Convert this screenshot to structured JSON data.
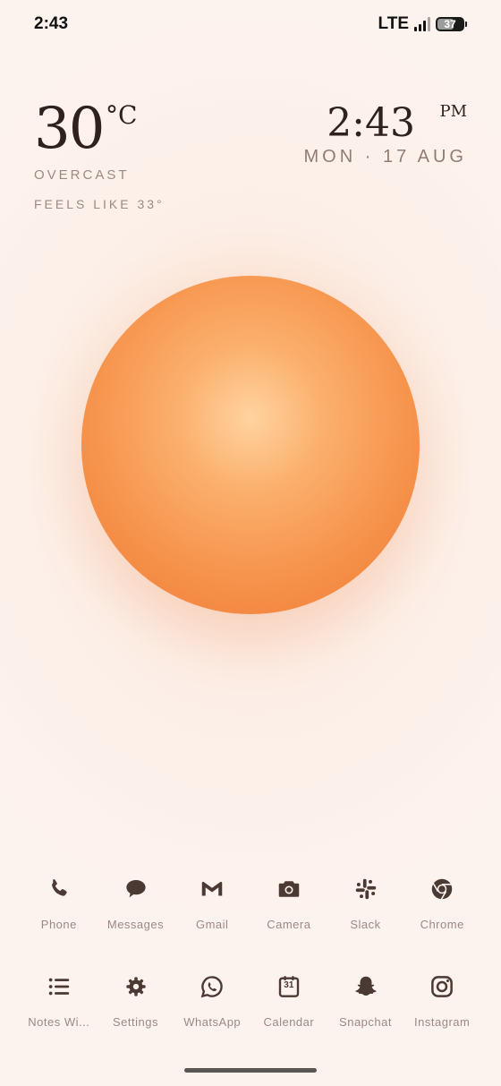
{
  "status_bar": {
    "time": "2:43",
    "network": "LTE",
    "battery": "37"
  },
  "weather": {
    "temperature": "30",
    "unit": "°C",
    "condition": "OVERCAST",
    "feels_like": "FEELS LIKE 33°"
  },
  "clock": {
    "time": "2:43",
    "ampm": "PM",
    "date": "MON · 17 AUG"
  },
  "colors": {
    "orb_center": "#ffd3a0",
    "orb_edge": "#ef7a35",
    "icon": "#4a3a33",
    "label": "#9a8a82"
  },
  "apps_row1": [
    {
      "label": "Phone",
      "icon": "phone-icon"
    },
    {
      "label": "Messages",
      "icon": "messages-icon"
    },
    {
      "label": "Gmail",
      "icon": "gmail-icon"
    },
    {
      "label": "Camera",
      "icon": "camera-icon"
    },
    {
      "label": "Slack",
      "icon": "slack-icon"
    },
    {
      "label": "Chrome",
      "icon": "chrome-icon"
    }
  ],
  "apps_row2": [
    {
      "label": "Notes Wi...",
      "icon": "notes-icon"
    },
    {
      "label": "Settings",
      "icon": "gear-icon"
    },
    {
      "label": "WhatsApp",
      "icon": "whatsapp-icon"
    },
    {
      "label": "Calendar",
      "icon": "calendar-icon",
      "badge": "31"
    },
    {
      "label": "Snapchat",
      "icon": "snapchat-icon"
    },
    {
      "label": "Instagram",
      "icon": "instagram-icon"
    }
  ]
}
